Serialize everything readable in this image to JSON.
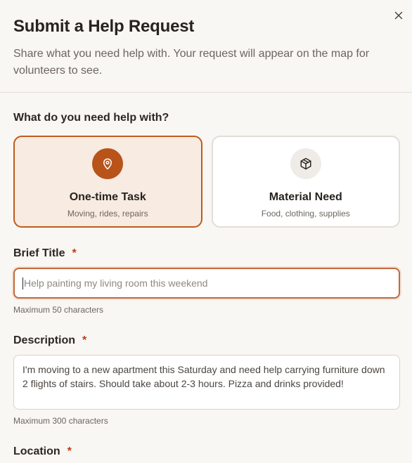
{
  "modal": {
    "title": "Submit a Help Request",
    "subtitle": "Share what you need help with. Your request will appear on the map for volunteers to see."
  },
  "type_section": {
    "label": "What do you need help with?",
    "options": [
      {
        "title": "One-time Task",
        "subtitle": "Moving, rides, repairs",
        "icon": "map-pin-icon",
        "selected": true
      },
      {
        "title": "Material Need",
        "subtitle": "Food, clothing, supplies",
        "icon": "package-icon",
        "selected": false
      }
    ]
  },
  "brief_title": {
    "label": "Brief Title",
    "required_mark": "*",
    "placeholder": "Help painting my living room this weekend",
    "value": "",
    "hint": "Maximum 50 characters"
  },
  "description": {
    "label": "Description",
    "required_mark": "*",
    "placeholder": "I'm moving to a new apartment this Saturday and need help carrying furniture down 2 flights of stairs. Should take about 2-3 hours. Pizza and drinks provided!",
    "value": "",
    "hint": "Maximum 300 characters"
  },
  "location": {
    "label": "Location",
    "required_mark": "*"
  },
  "colors": {
    "accent": "#b8531a",
    "selected_bg": "#f7ebe2",
    "required": "#c0391c"
  }
}
